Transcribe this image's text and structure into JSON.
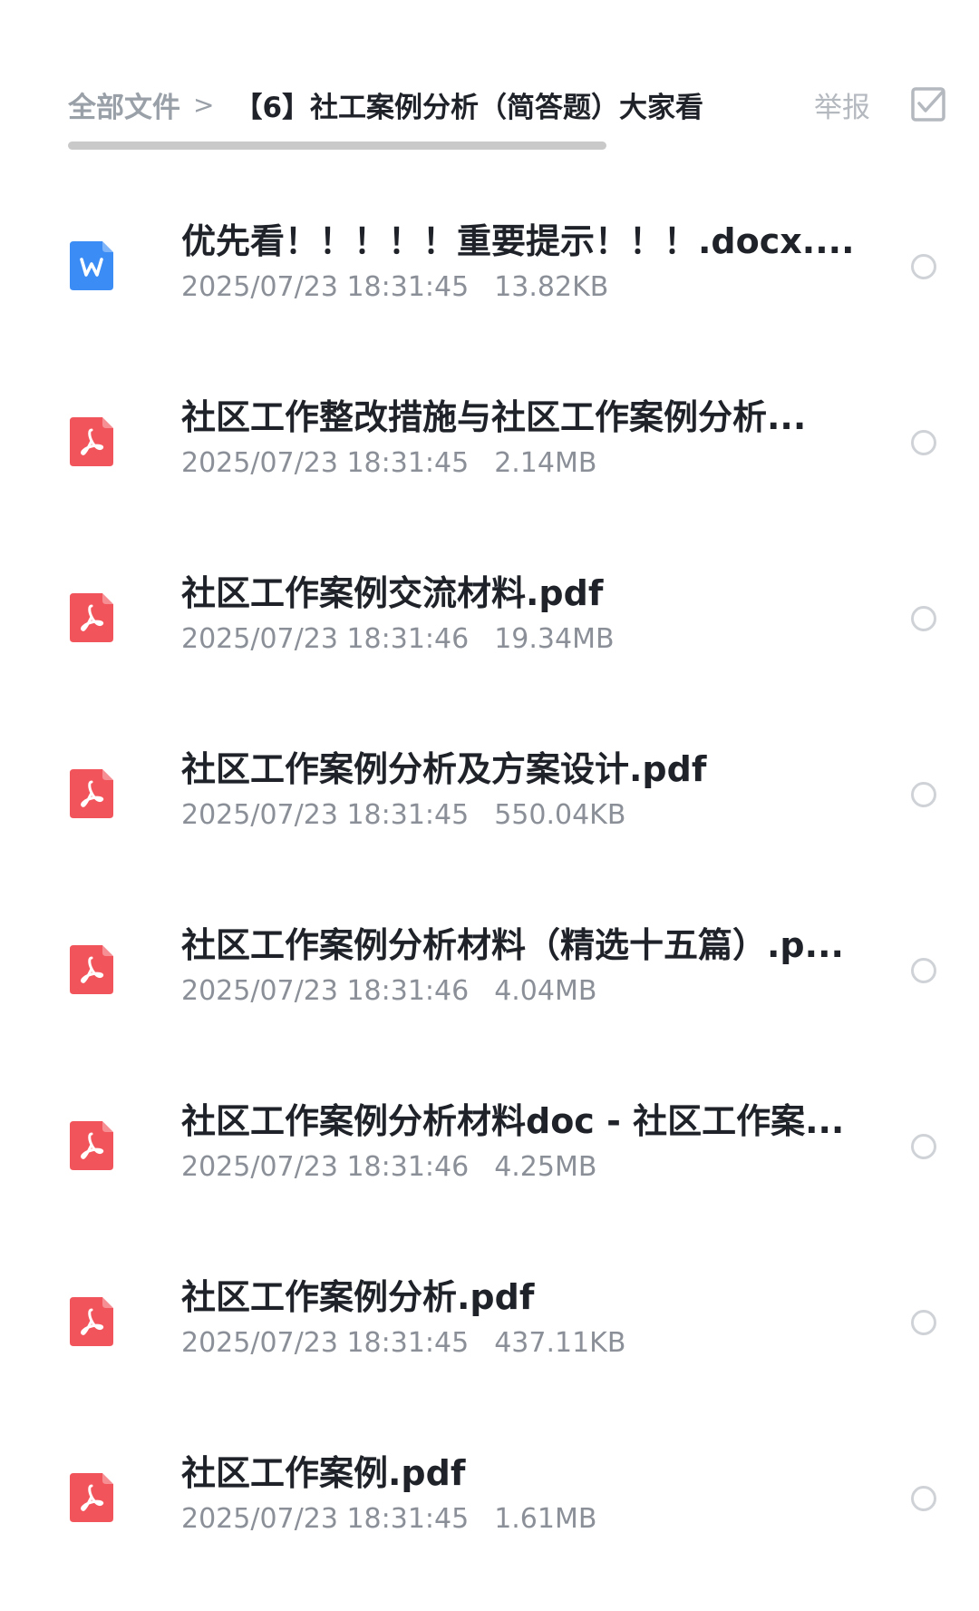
{
  "header": {
    "breadcrumb_root": "全部文件",
    "breadcrumb_separator": ">",
    "breadcrumb_current": "【6】社工案例分析（简答题）大家看",
    "report_label": "举报",
    "select_icon": "checkbox-check-icon"
  },
  "colors": {
    "word_icon": "#3b8cf5",
    "pdf_icon": "#f2545b",
    "title_text": "#1f2329",
    "meta_text": "#8b9098"
  },
  "files": [
    {
      "name": "优先看！！！！！重要提示！！！.docx....",
      "time": "2025/07/23 18:31:45",
      "size": "13.82KB",
      "type": "word"
    },
    {
      "name": "社区工作整改措施与社区工作案例分析...",
      "time": "2025/07/23 18:31:45",
      "size": "2.14MB",
      "type": "pdf"
    },
    {
      "name": "社区工作案例交流材料.pdf",
      "time": "2025/07/23 18:31:46",
      "size": "19.34MB",
      "type": "pdf"
    },
    {
      "name": "社区工作案例分析及方案设计.pdf",
      "time": "2025/07/23 18:31:45",
      "size": "550.04KB",
      "type": "pdf"
    },
    {
      "name": "社区工作案例分析材料（精选十五篇）.p...",
      "time": "2025/07/23 18:31:46",
      "size": "4.04MB",
      "type": "pdf"
    },
    {
      "name": "社区工作案例分析材料doc - 社区工作案...",
      "time": "2025/07/23 18:31:46",
      "size": "4.25MB",
      "type": "pdf"
    },
    {
      "name": "社区工作案例分析.pdf",
      "time": "2025/07/23 18:31:45",
      "size": "437.11KB",
      "type": "pdf"
    },
    {
      "name": "社区工作案例.pdf",
      "time": "2025/07/23 18:31:45",
      "size": "1.61MB",
      "type": "pdf"
    }
  ]
}
